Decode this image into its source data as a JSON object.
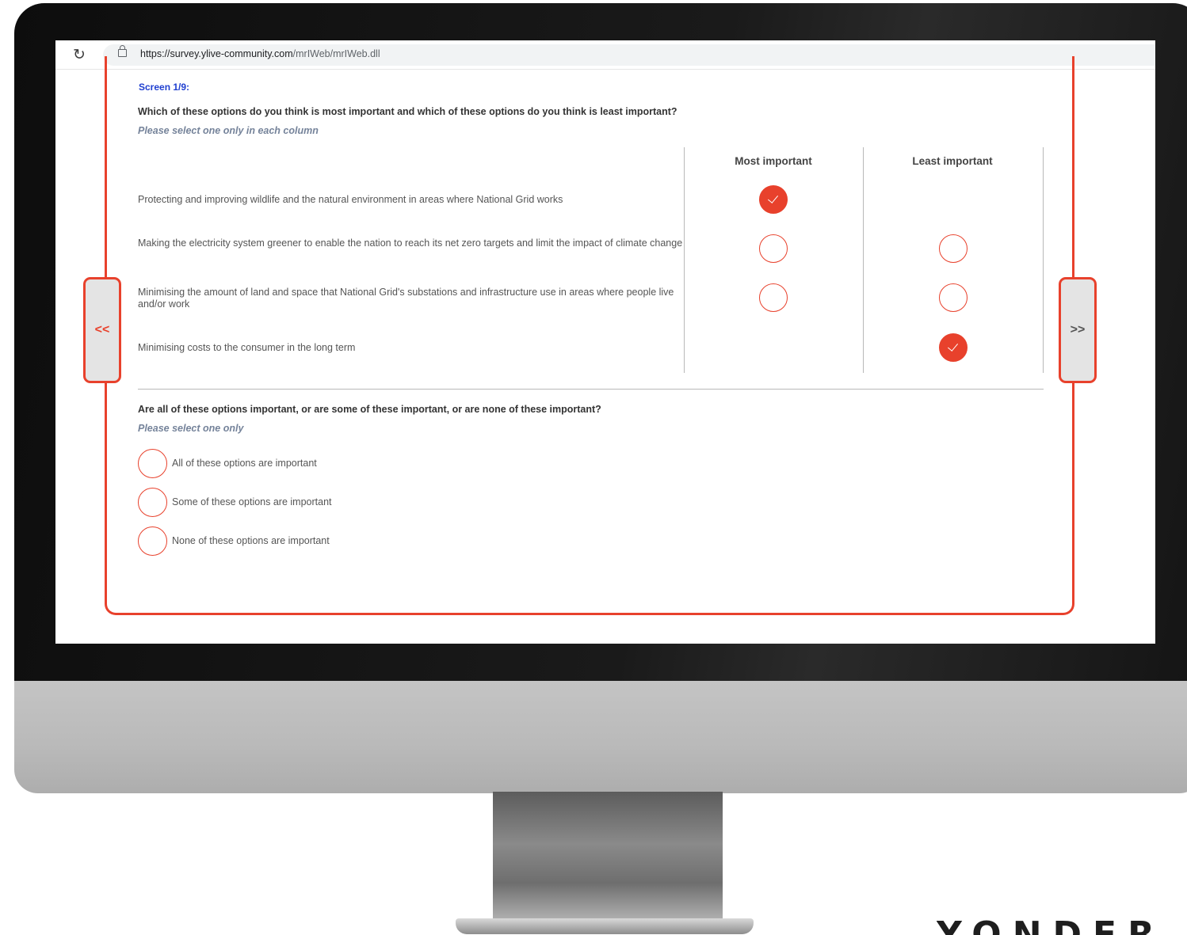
{
  "browser": {
    "url_host": "https://survey.ylive-community.com",
    "url_path": "/mrIWeb/mrIWeb.dll"
  },
  "survey": {
    "screen_label": "Screen 1/9:",
    "question1": "Which of these options do you think is most important and which of these options do you think is least important?",
    "question1_instruction": "Please select one only in each column",
    "columns": [
      "Most important",
      "Least important"
    ],
    "rows": [
      {
        "text": "Protecting and improving wildlife and the natural environment in areas where National Grid works",
        "most": "selected",
        "least": "hidden"
      },
      {
        "text": "Making the electricity system greener to enable the nation to reach its net zero targets and limit the impact of climate change",
        "most": "unselected",
        "least": "unselected"
      },
      {
        "text": "Minimising the amount of land and space that National Grid's substations and infrastructure use in areas where people live and/or work",
        "most": "unselected",
        "least": "unselected"
      },
      {
        "text": "Minimising costs to the consumer in the long term",
        "most": "hidden",
        "least": "selected"
      }
    ],
    "question2": "Are all of these options important, or are some of these important, or are none of these important?",
    "question2_instruction": "Please select one only",
    "question2_options": [
      "All of these options are important",
      "Some of these options are important",
      "None of these options are important"
    ],
    "nav_prev": "<<",
    "nav_next": ">>"
  },
  "brand": "YONDER",
  "colors": {
    "accent": "#e8412c",
    "screen_label": "#1f3fd0",
    "instruction": "#75839a"
  },
  "icons": {
    "reload": "reload-icon",
    "lock": "lock-icon",
    "check": "check-icon"
  }
}
